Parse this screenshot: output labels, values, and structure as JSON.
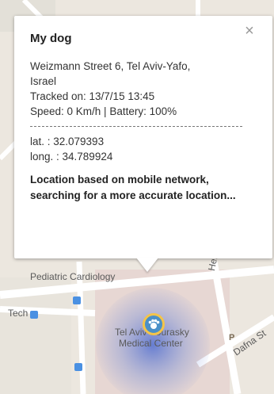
{
  "map": {
    "labels": {
      "pediatric": "Pediatric Cardiology",
      "tech": "Tech",
      "hospital_line1": "Tel Aviv Sourasky",
      "hospital_line2": "Medical Center",
      "street_henrietta": "Henrietta",
      "street_dafna": "Dafna St",
      "p_sign": "P"
    },
    "icons": {
      "marker": "paw-marker-icon",
      "close": "close-icon"
    }
  },
  "popup": {
    "title": "My dog",
    "close_label": "×",
    "address_line1": "Weizmann Street 6, Tel Aviv-Yafo,",
    "address_line2": "Israel",
    "tracked_on": "Tracked on: 13/7/15 13:45",
    "speed_battery": "Speed: 0 Km/h | Battery: 100%",
    "lat": "lat. : 32.079393",
    "long": "long. : 34.789924",
    "status": "Location based on mobile network, searching for a more accurate location..."
  },
  "colors": {
    "map_bg": "#ece7df",
    "accuracy_circle": "#6b86d6",
    "marker_ring": "#f3c44a",
    "marker_fill": "#4a90c8"
  }
}
